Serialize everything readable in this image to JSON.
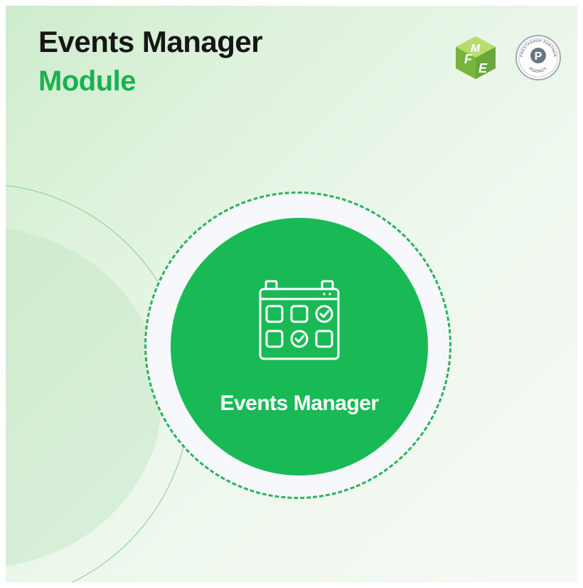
{
  "title": {
    "line1": "Events Manager",
    "line2": "Module"
  },
  "badge": {
    "label": "Events Manager",
    "icon": "calendar-check-icon"
  },
  "logos": {
    "fme": {
      "letters": [
        "F",
        "M",
        "E"
      ],
      "icon": "fme-cube-logo"
    },
    "partner": {
      "ring_text": "PRESTASHOP PARTNER",
      "bottom_text": "AGENCY",
      "letter": "P"
    }
  },
  "colors": {
    "brand_green": "#19ba55",
    "title_dark": "#161616",
    "module_green": "#19b150",
    "dashed_ring": "#2bb35a"
  }
}
